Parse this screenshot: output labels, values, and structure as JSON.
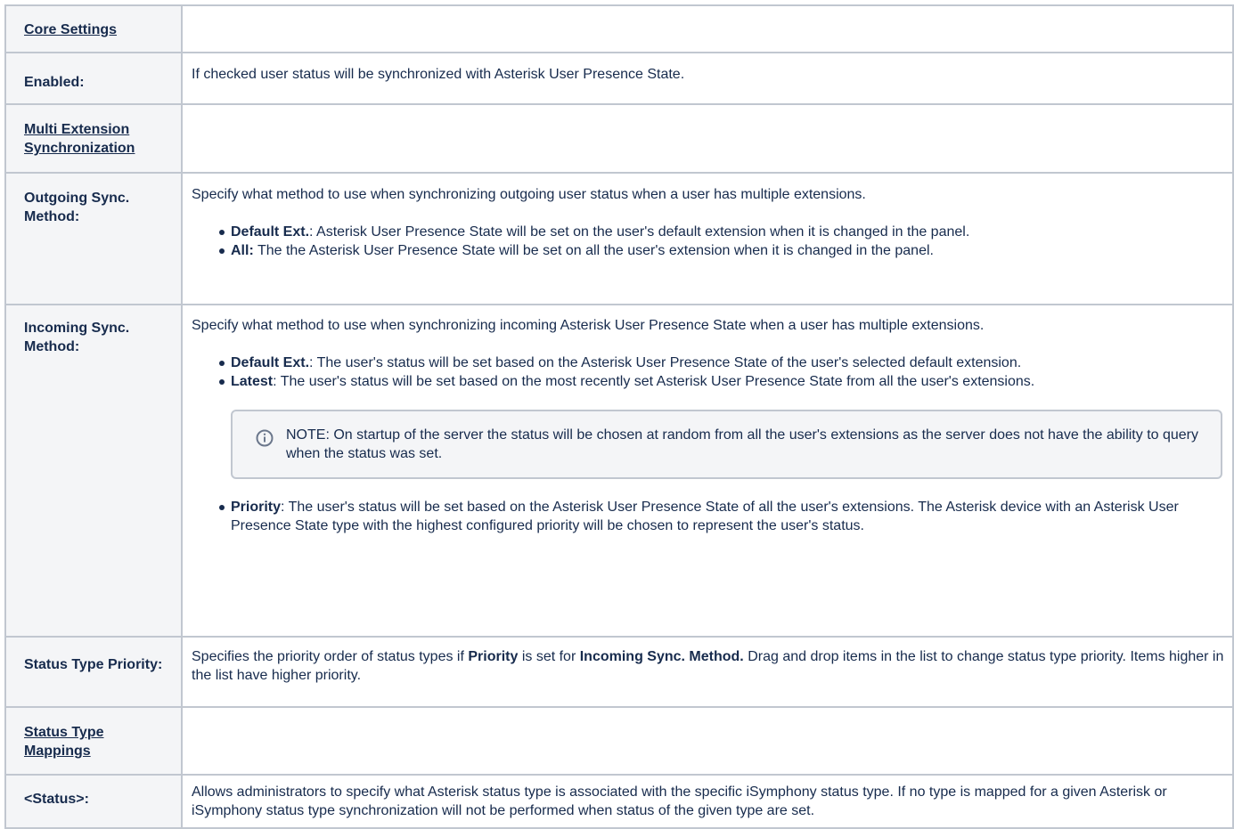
{
  "rows": {
    "core": {
      "label": "Core Settings"
    },
    "enabled": {
      "label": "Enabled:",
      "text": "If checked user status will be synchronized with Asterisk User Presence State."
    },
    "multi": {
      "label": "Multi Extension Synchronization"
    },
    "outgoing": {
      "label": "Outgoing Sync. Method:",
      "text": "Specify what method to use when synchronizing outgoing user status when a user has multiple extensions.",
      "items": [
        {
          "term": "Default Ext.",
          "sep": ": ",
          "text": "Asterisk User Presence State will be set on the user's default extension when it is changed in the panel."
        },
        {
          "term": "All:",
          "sep": " ",
          "text": "The the Asterisk User Presence State will be set on all the user's extension when it is changed in the panel."
        }
      ]
    },
    "incoming": {
      "label": "Incoming Sync. Method:",
      "text": "Specify what method to use when synchronizing incoming Asterisk User Presence State when a user has multiple extensions.",
      "items": [
        {
          "term": "Default Ext.",
          "sep": ": ",
          "text": "The user's status will be set based on the Asterisk User Presence State of the user's selected default extension."
        },
        {
          "term": "Latest",
          "sep": ": ",
          "text": "The user's status will be set based on the most recently set Asterisk User Presence State from all the user's extensions."
        }
      ],
      "note": "NOTE: On startup of the server the status will be chosen at random from all the user's extensions as the server does not have the ability to query when the status was set.",
      "items2": [
        {
          "term": "Priority",
          "sep": ": ",
          "text": "The user's status will be set based on the Asterisk User Presence State of all the user's extensions. The Asterisk device with an Asterisk User Presence State type with the highest configured priority will be chosen to represent the user's status."
        }
      ]
    },
    "priority": {
      "label": "Status Type Priority:",
      "pre": "Specifies the priority order of status types if ",
      "b1": "Priority",
      "mid": " is set for ",
      "b2": "Incoming Sync. Method.",
      "post": " Drag and drop items in the list to change status type priority. Items higher in the list have higher priority."
    },
    "mappings": {
      "label": "Status Type Mappings"
    },
    "status": {
      "label": "<Status>:",
      "text": "Allows administrators to specify what Asterisk status type is associated with the specific iSymphony status type. If no type is mapped for a given Asterisk or iSymphony status type synchronization will not be performed when status of the given type are set."
    }
  },
  "icons": {
    "note": "info-icon",
    "note_color": "#6b778c"
  }
}
